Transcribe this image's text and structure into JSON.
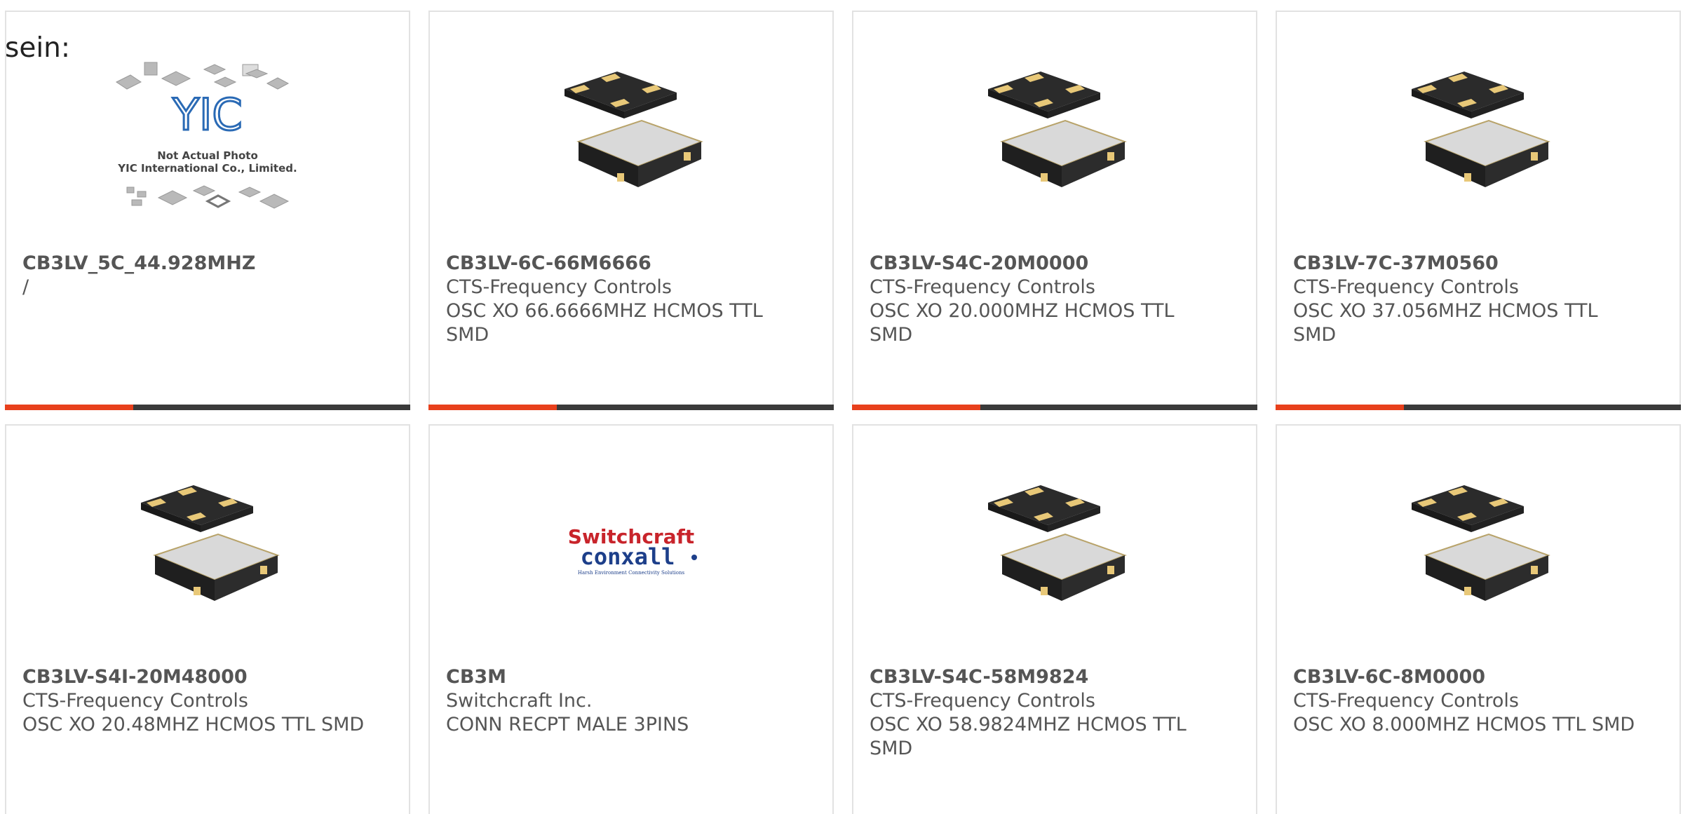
{
  "overlay_text": "sein:",
  "colors": {
    "accent": "#e8401c",
    "bar": "#3a3a3a",
    "border": "#e2e2e2",
    "text": "#555555"
  },
  "products": [
    {
      "part": "CB3LV_5C_44.928MHZ",
      "maker": "/",
      "desc": "",
      "image": "placeholder-photo",
      "placeholder_line1": "Not Actual Photo",
      "placeholder_line2": "YIC International Co., Limited.",
      "logo_text": "YIC"
    },
    {
      "part": "CB3LV-6C-66M6666",
      "maker": "CTS-Frequency Controls",
      "desc": "OSC XO 66.6666MHZ HCMOS TTL SMD",
      "image": "oscillator-chip"
    },
    {
      "part": "CB3LV-S4C-20M0000",
      "maker": "CTS-Frequency Controls",
      "desc": "OSC XO 20.000MHZ HCMOS TTL SMD",
      "image": "oscillator-chip"
    },
    {
      "part": "CB3LV-7C-37M0560",
      "maker": "CTS-Frequency Controls",
      "desc": "OSC XO 37.056MHZ HCMOS TTL SMD",
      "image": "oscillator-chip"
    },
    {
      "part": "CB3LV-S4I-20M48000",
      "maker": "CTS-Frequency Controls",
      "desc": "OSC XO 20.48MHZ HCMOS TTL SMD",
      "image": "oscillator-chip"
    },
    {
      "part": "CB3M",
      "maker": "Switchcraft Inc.",
      "desc": "CONN RECPT MALE 3PINS",
      "image": "switchcraft-logo",
      "logo_line1": "Switchcraft",
      "logo_line2": "conxall",
      "logo_tagline": "Harsh Environment Connectivity Solutions"
    },
    {
      "part": "CB3LV-S4C-58M9824",
      "maker": "CTS-Frequency Controls",
      "desc": "OSC XO 58.9824MHZ HCMOS TTL SMD",
      "image": "oscillator-chip"
    },
    {
      "part": "CB3LV-6C-8M0000",
      "maker": "CTS-Frequency Controls",
      "desc": "OSC XO 8.000MHZ HCMOS TTL SMD",
      "image": "oscillator-chip"
    }
  ]
}
